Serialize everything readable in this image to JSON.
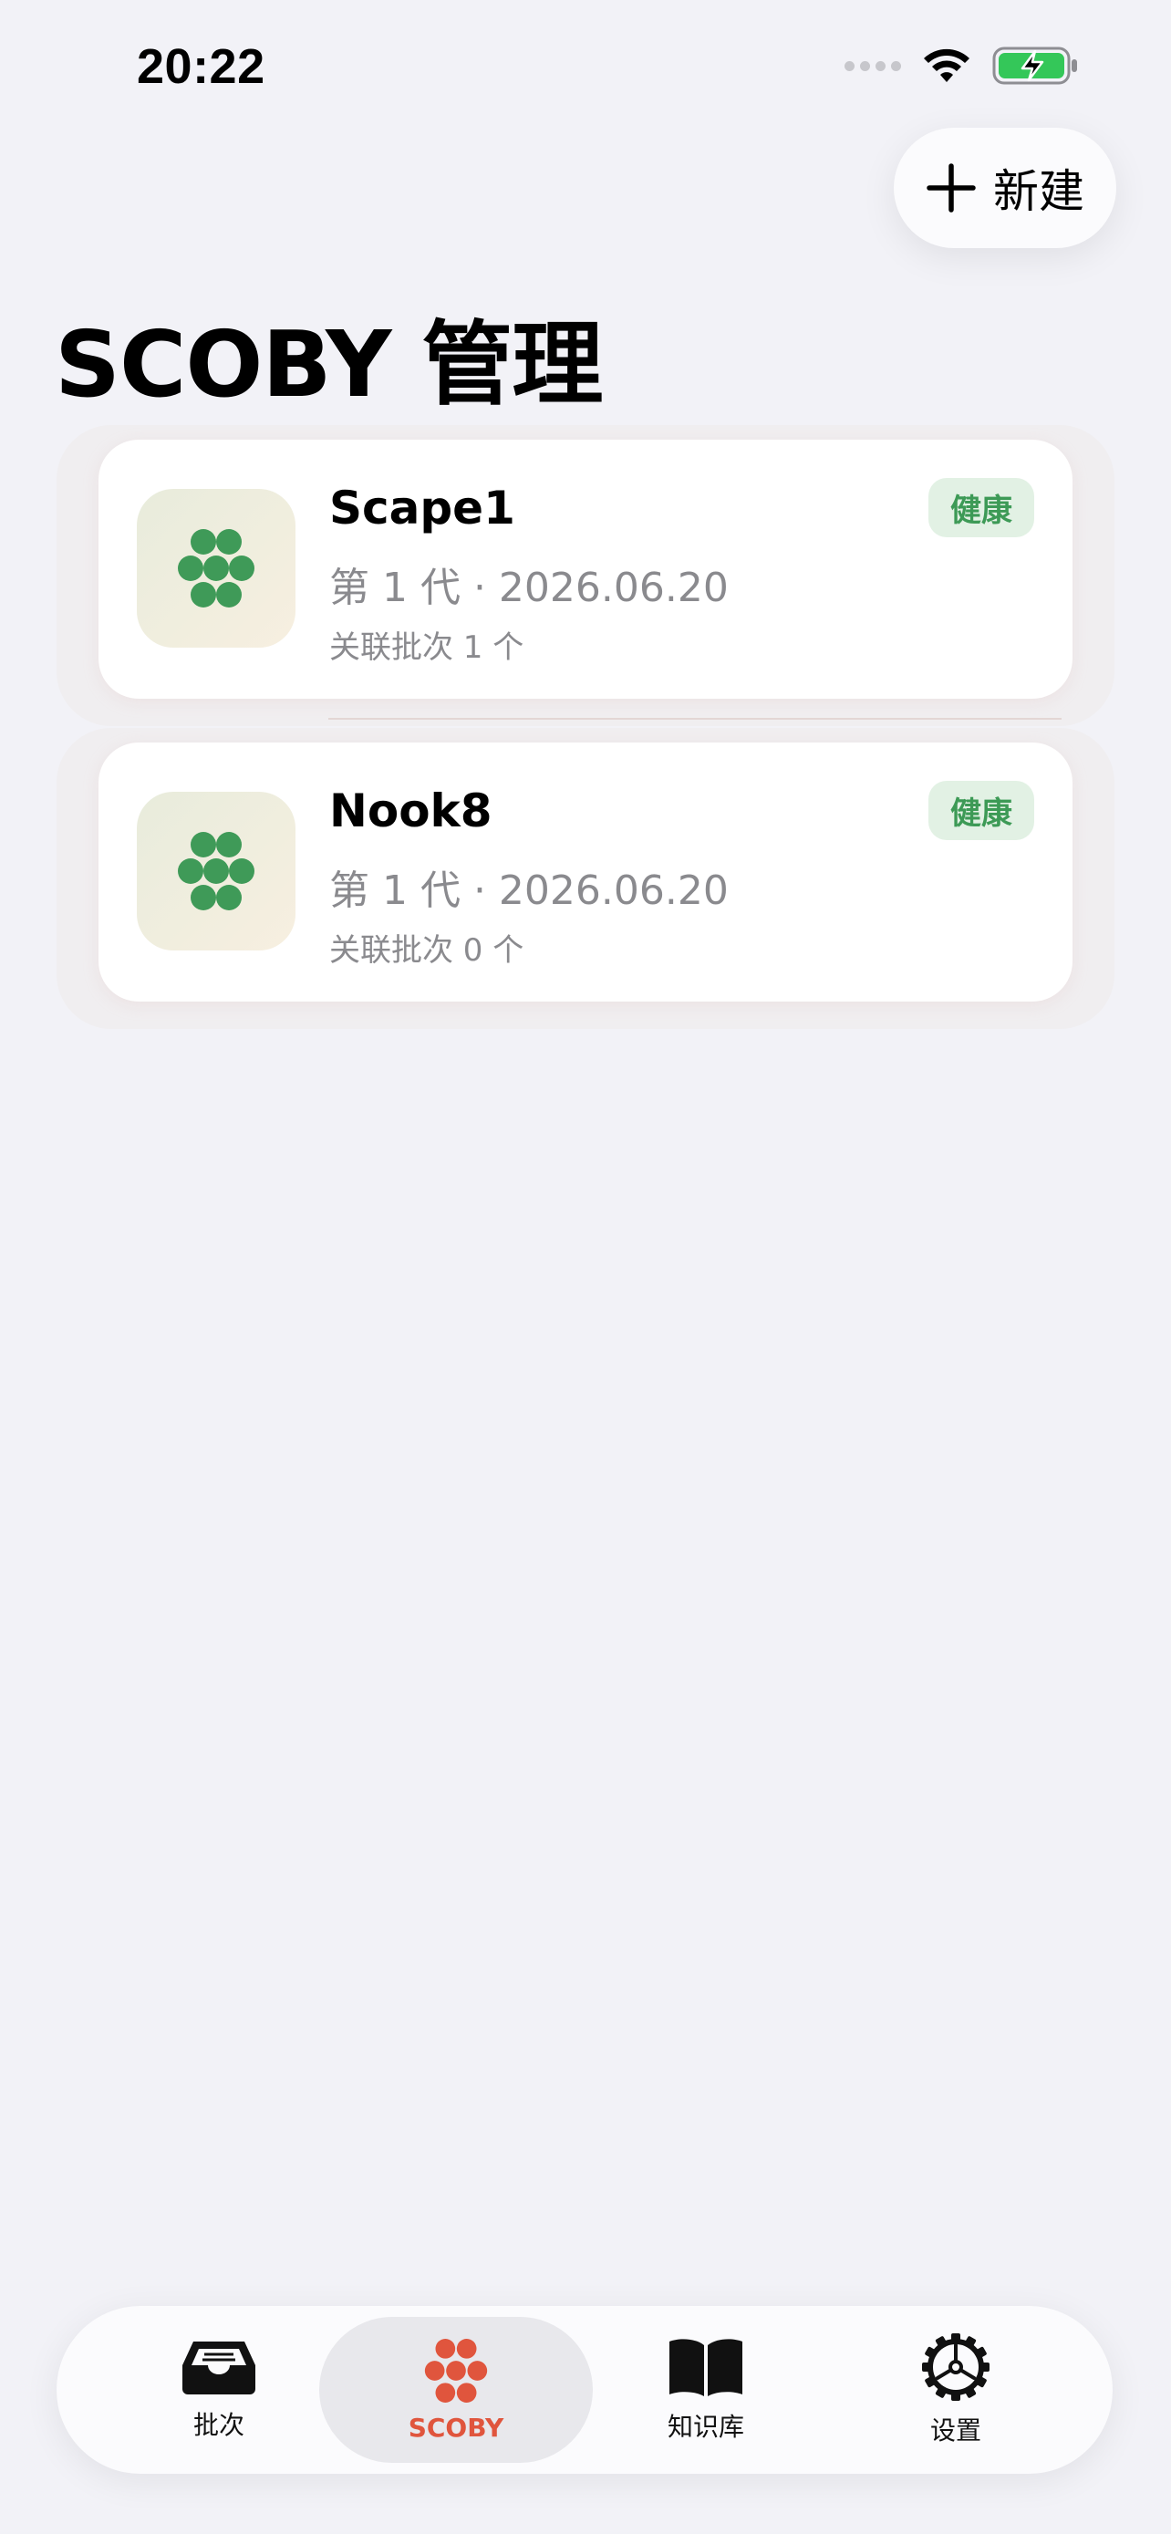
{
  "status_bar": {
    "time": "20:22"
  },
  "header": {
    "new_button_label": "新建",
    "title": "SCOBY 管理"
  },
  "scobys": [
    {
      "name": "Scape1",
      "meta": "第 1 代 · 2026.06.20",
      "linked": "关联批次 1 个",
      "status": "健康"
    },
    {
      "name": "Nook8",
      "meta": "第 1 代 · 2026.06.20",
      "linked": "关联批次 0 个",
      "status": "健康"
    }
  ],
  "tabs": [
    {
      "label": "批次",
      "icon": "tray-icon"
    },
    {
      "label": "SCOBY",
      "icon": "scoby-cluster-icon",
      "active": true
    },
    {
      "label": "知识库",
      "icon": "book-icon"
    },
    {
      "label": "设置",
      "icon": "gear-icon"
    }
  ],
  "colors": {
    "accent": "#e0553d",
    "healthy": "#3d9a56",
    "healthy_bg": "#e2f1e4",
    "scoby_icon": "#3f9a58"
  }
}
